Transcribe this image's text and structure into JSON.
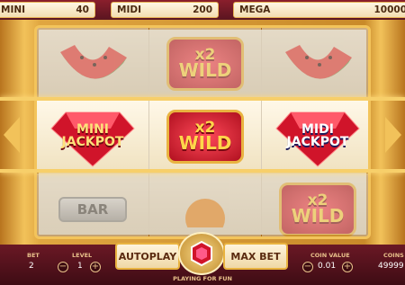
{
  "jackpots": [
    {
      "label": "MINI",
      "value": "40"
    },
    {
      "label": "MIDI",
      "value": "200"
    },
    {
      "label": "MEGA",
      "value": "10000"
    }
  ],
  "reels": {
    "top": [
      "watermelon",
      "WILD",
      "watermelon"
    ],
    "middle": [
      {
        "line1": "MINI",
        "line2": "JACKPOT"
      },
      {
        "line1": "x2",
        "line2": "WILD"
      },
      {
        "line1": "MIDI",
        "line2": "JACKPOT"
      }
    ],
    "bottom": [
      "BAR",
      "",
      "WILD"
    ]
  },
  "symbols": {
    "wild_multiplier": "x2",
    "wild": "WILD",
    "bar": "BAR"
  },
  "controls": {
    "autoplay_label": "AUTOPLAY",
    "maxbet_label": "MAX BET",
    "bet_label": "BET",
    "bet_value": "2",
    "level_label": "LEVEL",
    "level_value": "1",
    "coin_value_label": "COIN VALUE",
    "coin_value": "0.01",
    "coins_label": "COINS",
    "coins_value": "49999",
    "minus": "−",
    "plus": "+",
    "fun_text": "PLAYING FOR FUN"
  },
  "colors": {
    "gold": "#f3c45b",
    "maroon": "#5a1520",
    "ruby": "#d0142a"
  }
}
